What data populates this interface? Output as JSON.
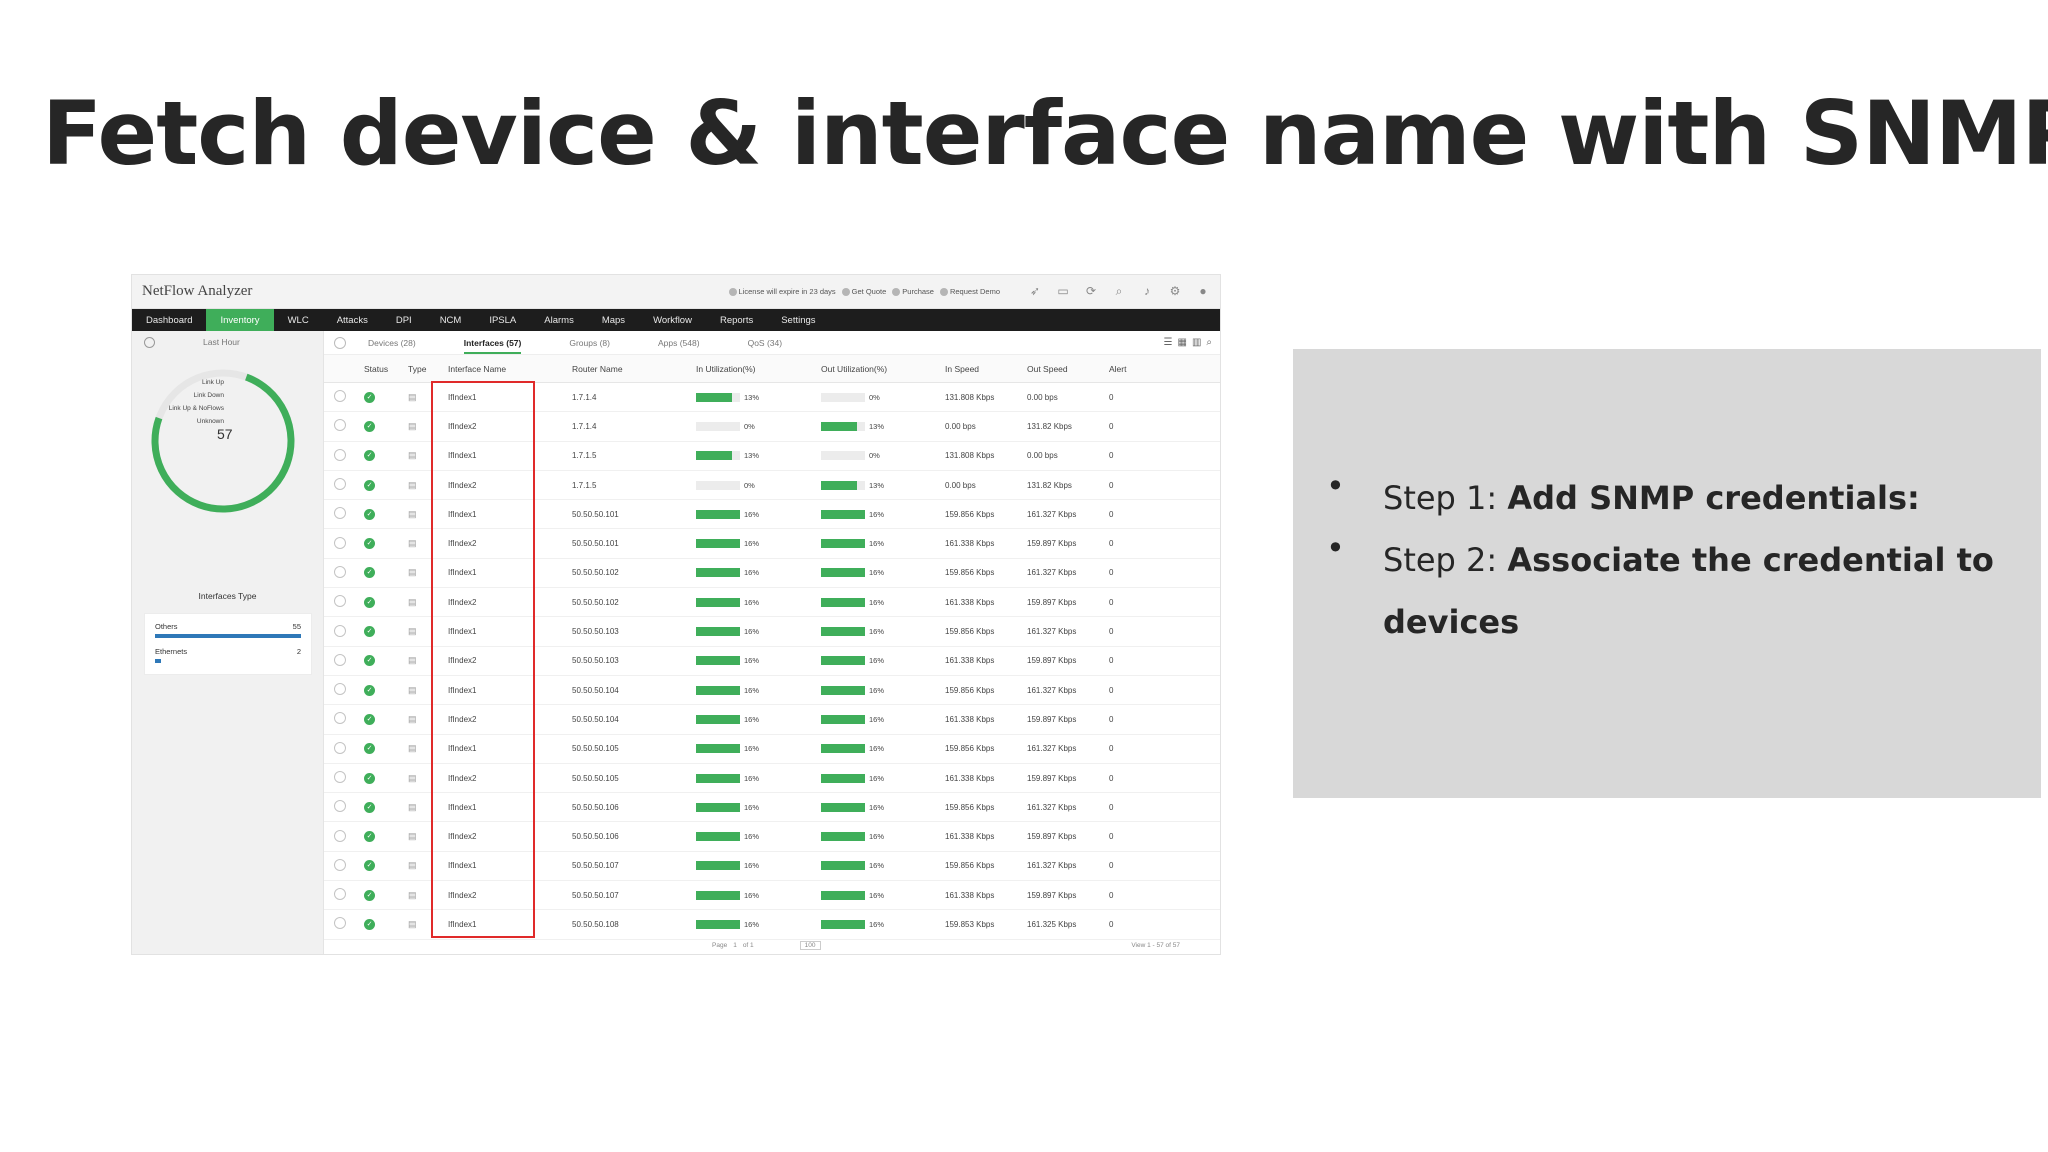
{
  "slide": {
    "title": "Fetch device & interface name with SNMP"
  },
  "app": {
    "name": "NetFlow Analyzer",
    "header_links": [
      "License will expire in 23 days",
      "Get Quote",
      "Purchase",
      "Request Demo"
    ],
    "header_icons": [
      "rocket-icon",
      "monitor-icon",
      "sync-icon",
      "search-icon",
      "bell-icon",
      "gear-icon",
      "user-icon"
    ],
    "nav": [
      "Dashboard",
      "Inventory",
      "WLC",
      "Attacks",
      "DPI",
      "NCM",
      "IPSLA",
      "Alarms",
      "Maps",
      "Workflow",
      "Reports",
      "Settings"
    ],
    "nav_active": "Inventory",
    "time_range": "Last Hour",
    "donut": {
      "legend": [
        "Link Up",
        "Link Down",
        "Link Up & NoFlows",
        "Unknown"
      ],
      "total": "57",
      "color": "#3fae5a"
    },
    "interfaces_type": {
      "label": "Interfaces Type",
      "items": [
        {
          "name": "Others",
          "count": "55"
        },
        {
          "name": "Ethernets",
          "count": "2"
        }
      ]
    },
    "tabs": [
      "Devices (28)",
      "Interfaces (57)",
      "Groups (8)",
      "Apps (548)",
      "QoS (34)"
    ],
    "tab_active": "Interfaces (57)",
    "columns": [
      "Status",
      "Type",
      "Interface Name",
      "Router Name",
      "In Utilization(%)",
      "Out Utilization(%)",
      "In Speed",
      "Out Speed",
      "Alert"
    ],
    "rows": [
      {
        "iface": "IfIndex1",
        "router": "1.7.1.4",
        "in_util": "13%",
        "in_val": 13,
        "out_util": "0%",
        "out_val": 0,
        "in_speed": "131.808 Kbps",
        "out_speed": "0.00 bps",
        "alert": "0"
      },
      {
        "iface": "IfIndex2",
        "router": "1.7.1.4",
        "in_util": "0%",
        "in_val": 0,
        "out_util": "13%",
        "out_val": 13,
        "in_speed": "0.00 bps",
        "out_speed": "131.82 Kbps",
        "alert": "0"
      },
      {
        "iface": "IfIndex1",
        "router": "1.7.1.5",
        "in_util": "13%",
        "in_val": 13,
        "out_util": "0%",
        "out_val": 0,
        "in_speed": "131.808 Kbps",
        "out_speed": "0.00 bps",
        "alert": "0"
      },
      {
        "iface": "IfIndex2",
        "router": "1.7.1.5",
        "in_util": "0%",
        "in_val": 0,
        "out_util": "13%",
        "out_val": 13,
        "in_speed": "0.00 bps",
        "out_speed": "131.82 Kbps",
        "alert": "0"
      },
      {
        "iface": "IfIndex1",
        "router": "50.50.50.101",
        "in_util": "16%",
        "in_val": 16,
        "out_util": "16%",
        "out_val": 16,
        "in_speed": "159.856 Kbps",
        "out_speed": "161.327 Kbps",
        "alert": "0"
      },
      {
        "iface": "IfIndex2",
        "router": "50.50.50.101",
        "in_util": "16%",
        "in_val": 16,
        "out_util": "16%",
        "out_val": 16,
        "in_speed": "161.338 Kbps",
        "out_speed": "159.897 Kbps",
        "alert": "0"
      },
      {
        "iface": "IfIndex1",
        "router": "50.50.50.102",
        "in_util": "16%",
        "in_val": 16,
        "out_util": "16%",
        "out_val": 16,
        "in_speed": "159.856 Kbps",
        "out_speed": "161.327 Kbps",
        "alert": "0"
      },
      {
        "iface": "IfIndex2",
        "router": "50.50.50.102",
        "in_util": "16%",
        "in_val": 16,
        "out_util": "16%",
        "out_val": 16,
        "in_speed": "161.338 Kbps",
        "out_speed": "159.897 Kbps",
        "alert": "0"
      },
      {
        "iface": "IfIndex1",
        "router": "50.50.50.103",
        "in_util": "16%",
        "in_val": 16,
        "out_util": "16%",
        "out_val": 16,
        "in_speed": "159.856 Kbps",
        "out_speed": "161.327 Kbps",
        "alert": "0"
      },
      {
        "iface": "IfIndex2",
        "router": "50.50.50.103",
        "in_util": "16%",
        "in_val": 16,
        "out_util": "16%",
        "out_val": 16,
        "in_speed": "161.338 Kbps",
        "out_speed": "159.897 Kbps",
        "alert": "0"
      },
      {
        "iface": "IfIndex1",
        "router": "50.50.50.104",
        "in_util": "16%",
        "in_val": 16,
        "out_util": "16%",
        "out_val": 16,
        "in_speed": "159.856 Kbps",
        "out_speed": "161.327 Kbps",
        "alert": "0"
      },
      {
        "iface": "IfIndex2",
        "router": "50.50.50.104",
        "in_util": "16%",
        "in_val": 16,
        "out_util": "16%",
        "out_val": 16,
        "in_speed": "161.338 Kbps",
        "out_speed": "159.897 Kbps",
        "alert": "0"
      },
      {
        "iface": "IfIndex1",
        "router": "50.50.50.105",
        "in_util": "16%",
        "in_val": 16,
        "out_util": "16%",
        "out_val": 16,
        "in_speed": "159.856 Kbps",
        "out_speed": "161.327 Kbps",
        "alert": "0"
      },
      {
        "iface": "IfIndex2",
        "router": "50.50.50.105",
        "in_util": "16%",
        "in_val": 16,
        "out_util": "16%",
        "out_val": 16,
        "in_speed": "161.338 Kbps",
        "out_speed": "159.897 Kbps",
        "alert": "0"
      },
      {
        "iface": "IfIndex1",
        "router": "50.50.50.106",
        "in_util": "16%",
        "in_val": 16,
        "out_util": "16%",
        "out_val": 16,
        "in_speed": "159.856 Kbps",
        "out_speed": "161.327 Kbps",
        "alert": "0"
      },
      {
        "iface": "IfIndex2",
        "router": "50.50.50.106",
        "in_util": "16%",
        "in_val": 16,
        "out_util": "16%",
        "out_val": 16,
        "in_speed": "161.338 Kbps",
        "out_speed": "159.897 Kbps",
        "alert": "0"
      },
      {
        "iface": "IfIndex1",
        "router": "50.50.50.107",
        "in_util": "16%",
        "in_val": 16,
        "out_util": "16%",
        "out_val": 16,
        "in_speed": "159.856 Kbps",
        "out_speed": "161.327 Kbps",
        "alert": "0"
      },
      {
        "iface": "IfIndex2",
        "router": "50.50.50.107",
        "in_util": "16%",
        "in_val": 16,
        "out_util": "16%",
        "out_val": 16,
        "in_speed": "161.338 Kbps",
        "out_speed": "159.897 Kbps",
        "alert": "0"
      },
      {
        "iface": "IfIndex1",
        "router": "50.50.50.108",
        "in_util": "16%",
        "in_val": 16,
        "out_util": "16%",
        "out_val": 16,
        "in_speed": "159.853 Kbps",
        "out_speed": "161.325 Kbps",
        "alert": "0"
      }
    ],
    "footer": {
      "page_label": "Page",
      "page_value": "1",
      "page_of": "of 1",
      "page_size": "100",
      "view_info": "View 1 - 57 of 57"
    },
    "highlight_color": "#e02a2a"
  },
  "steps": [
    {
      "prefix": "Step 1: ",
      "bold": "Add SNMP credentials:"
    },
    {
      "prefix": "Step 2: ",
      "bold": "Associate the credential to devices"
    }
  ],
  "colors": {
    "accent": "#3fae5a",
    "nav_bg": "#1d1d1d",
    "steps_bg": "#d8d8d8"
  }
}
